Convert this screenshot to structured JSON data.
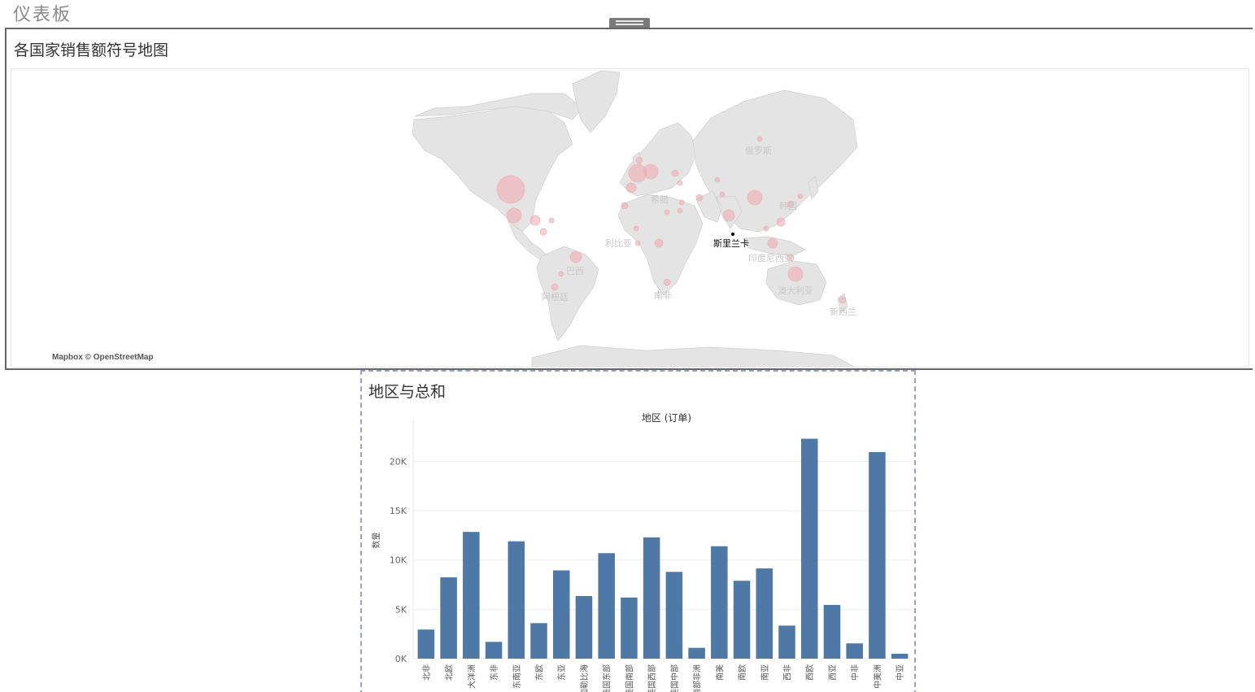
{
  "dashboard": {
    "title": "仪表板"
  },
  "map_panel": {
    "title": "各国家销售额符号地图",
    "attribution": "Mapbox © OpenStreetMap",
    "highlight_label": "斯里兰卡",
    "labels": [
      "俄罗斯",
      "希腊",
      "韩国",
      "利比亚",
      "印度尼西亚",
      "巴西",
      "阿根廷",
      "南非",
      "澳大利亚",
      "新西兰"
    ]
  },
  "bar_panel": {
    "title": "地区与总和"
  },
  "chart_data": {
    "type": "bar",
    "title": "地区 (订单)",
    "xlabel": "",
    "ylabel": "数量",
    "ylim": [
      0,
      23500
    ],
    "yticks": [
      0,
      5000,
      10000,
      15000,
      20000
    ],
    "ytick_labels": [
      "0K",
      "5K",
      "10K",
      "15K",
      "20K"
    ],
    "grid": true,
    "color": "#4e79a7",
    "categories": [
      "北非",
      "北欧",
      "大洋洲",
      "东非",
      "东南亚",
      "东欧",
      "东亚",
      "加勒比海",
      "美国东部",
      "美国南部",
      "美国西部",
      "美国中部",
      "南部非洲",
      "南美",
      "南欧",
      "南亚",
      "西非",
      "西欧",
      "西亚",
      "中非",
      "中美洲",
      "中亚"
    ],
    "values": [
      2950,
      8250,
      12850,
      1700,
      11900,
      3600,
      8950,
      6350,
      10700,
      6200,
      12300,
      8800,
      1100,
      11400,
      7900,
      9150,
      3350,
      22300,
      5450,
      1550,
      20950,
      500
    ]
  }
}
